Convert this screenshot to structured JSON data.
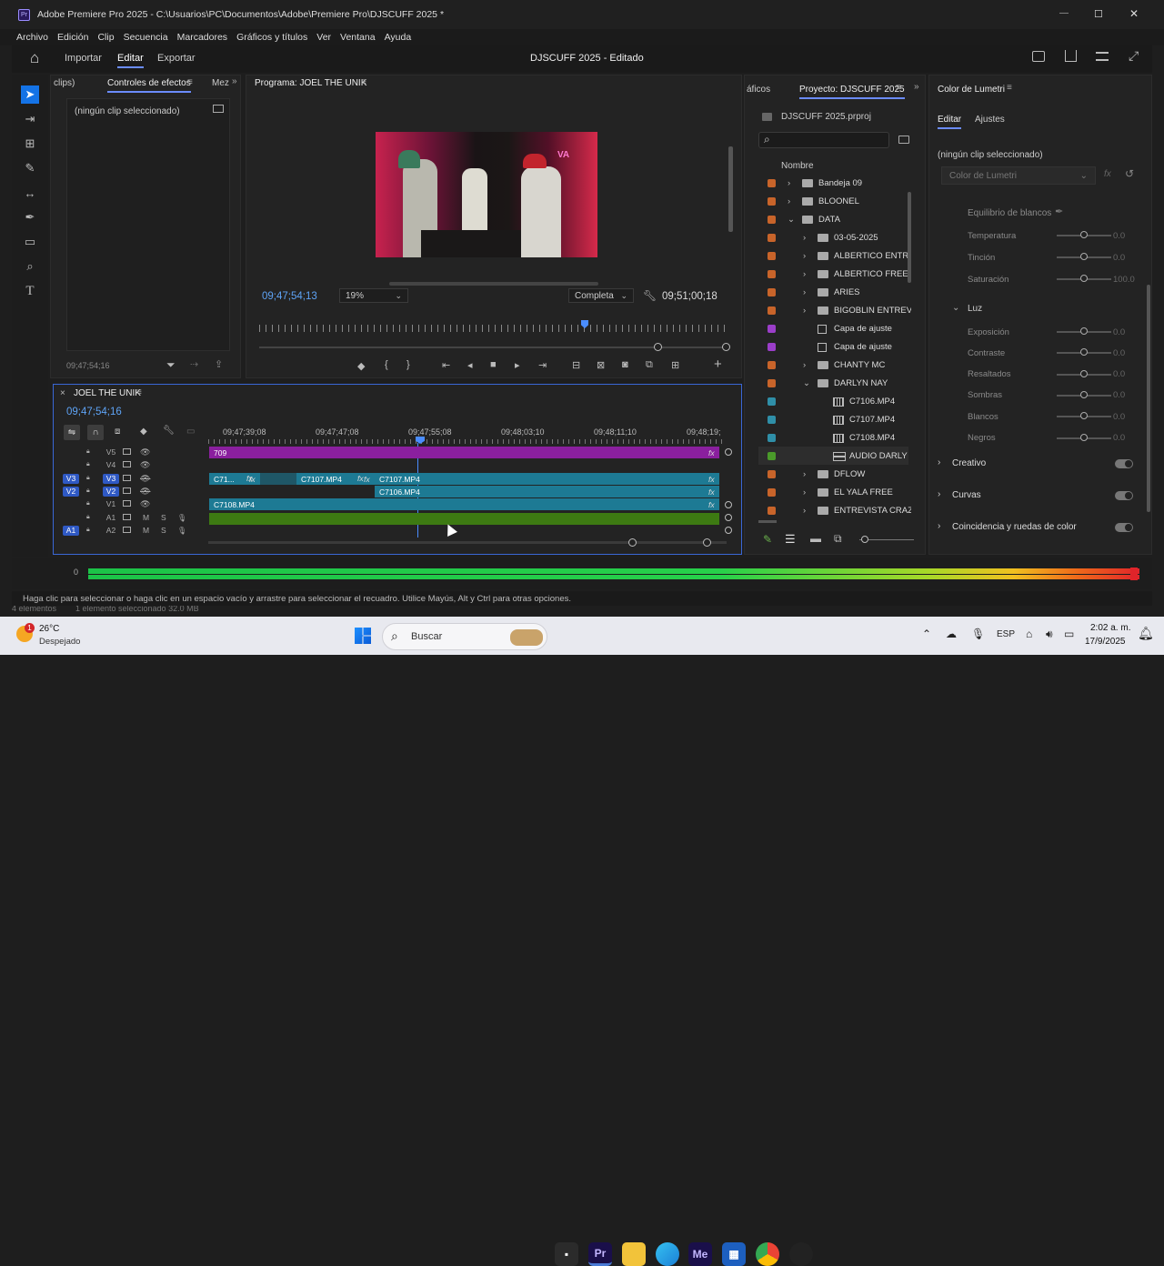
{
  "window": {
    "title": "Adobe Premiere Pro 2025 - C:\\Usuarios\\PC\\Documentos\\Adobe\\Premiere Pro\\DJSCUFF 2025 *",
    "min": "—",
    "max": "☐",
    "close": "✕"
  },
  "menu": [
    "Archivo",
    "Edición",
    "Clip",
    "Secuencia",
    "Marcadores",
    "Gráficos y títulos",
    "Ver",
    "Ventana",
    "Ayuda"
  ],
  "topbar": {
    "home": "⌂",
    "tabs": [
      "Importar",
      "Editar",
      "Exportar"
    ],
    "title": "DJSCUFF 2025 - Editado"
  },
  "source": {
    "tabs": [
      "clips)",
      "Controles de efectos",
      "Mez"
    ],
    "noclip": "(ningún clip seleccionado)",
    "timecode": "09;47;54;16"
  },
  "program": {
    "tab": "Programa: JOEL THE UNIK",
    "tc_left": "09;47;54;13",
    "zoom": "19%",
    "quality": "Completa",
    "tc_right": "09;51;00;18"
  },
  "project": {
    "tabs": [
      "áficos",
      "Proyecto: DJSCUFF 2025"
    ],
    "file": "DJSCUFF 2025.prproj",
    "col_name": "Nombre",
    "items": [
      {
        "name": "Bandeja 09",
        "color": "#c8642a",
        "indent": 0,
        "type": "folder",
        "arrow": "›"
      },
      {
        "name": "BLOONEL",
        "color": "#c8642a",
        "indent": 0,
        "type": "folder",
        "arrow": "›"
      },
      {
        "name": "DATA",
        "color": "#c8642a",
        "indent": 0,
        "type": "folder",
        "arrow": "⌄"
      },
      {
        "name": "03-05-2025",
        "color": "#c8642a",
        "indent": 1,
        "type": "folder",
        "arrow": "›"
      },
      {
        "name": "ALBERTICO ENTRE",
        "color": "#c8642a",
        "indent": 1,
        "type": "folder",
        "arrow": "›"
      },
      {
        "name": "ALBERTICO FREE",
        "color": "#c8642a",
        "indent": 1,
        "type": "folder",
        "arrow": "›"
      },
      {
        "name": "ARIES",
        "color": "#c8642a",
        "indent": 1,
        "type": "folder",
        "arrow": "›"
      },
      {
        "name": "BIGOBLIN ENTREV",
        "color": "#c8642a",
        "indent": 1,
        "type": "folder",
        "arrow": "›"
      },
      {
        "name": "Capa de ajuste",
        "color": "#9b3ec9",
        "indent": 1,
        "type": "adj",
        "arrow": ""
      },
      {
        "name": "Capa de ajuste",
        "color": "#9b3ec9",
        "indent": 1,
        "type": "adj",
        "arrow": ""
      },
      {
        "name": "CHANTY MC",
        "color": "#c8642a",
        "indent": 1,
        "type": "folder",
        "arrow": "›"
      },
      {
        "name": "DARLYN NAY",
        "color": "#c8642a",
        "indent": 1,
        "type": "folder",
        "arrow": "⌄"
      },
      {
        "name": "C7106.MP4",
        "color": "#2f8fa8",
        "indent": 2,
        "type": "video",
        "arrow": ""
      },
      {
        "name": "C7107.MP4",
        "color": "#2f8fa8",
        "indent": 2,
        "type": "video",
        "arrow": ""
      },
      {
        "name": "C7108.MP4",
        "color": "#2f8fa8",
        "indent": 2,
        "type": "video",
        "arrow": ""
      },
      {
        "name": "AUDIO DARLY",
        "color": "#4a9a2a",
        "indent": 2,
        "type": "audio",
        "arrow": ""
      },
      {
        "name": "DFLOW",
        "color": "#c8642a",
        "indent": 1,
        "type": "folder",
        "arrow": "›"
      },
      {
        "name": "EL YALA FREE",
        "color": "#c8642a",
        "indent": 1,
        "type": "folder",
        "arrow": "›"
      },
      {
        "name": "ENTREVISTA CRAZ",
        "color": "#c8642a",
        "indent": 1,
        "type": "folder",
        "arrow": "›"
      }
    ]
  },
  "lumetri": {
    "tab": "Color de Lumetri",
    "subtabs": [
      "Editar",
      "Ajustes"
    ],
    "noclip": "(ningún clip seleccionado)",
    "dropdown": "Color de Lumetri",
    "wb": "Equilibrio de blancos",
    "rows": [
      {
        "label": "Temperatura",
        "value": "0.0"
      },
      {
        "label": "Tinción",
        "value": "0.0"
      },
      {
        "label": "Saturación",
        "value": "100.0"
      }
    ],
    "luz": "Luz",
    "luzrows": [
      {
        "label": "Exposición",
        "value": "0.0"
      },
      {
        "label": "Contraste",
        "value": "0.0"
      },
      {
        "label": "Resaltados",
        "value": "0.0"
      },
      {
        "label": "Sombras",
        "value": "0.0"
      },
      {
        "label": "Blancos",
        "value": "0.0"
      },
      {
        "label": "Negros",
        "value": "0.0"
      }
    ],
    "sections": [
      "Creativo",
      "Curvas",
      "Coincidencia y ruedas de color"
    ]
  },
  "timeline": {
    "tab": "JOEL THE UNIK",
    "timecode": "09;47;54;16",
    "ruler": [
      "09;47;39;08",
      "09;47;47;08",
      "09;47;55;08",
      "09;48;03;10",
      "09;48;11;10",
      "09;48;19;"
    ],
    "tracks": [
      {
        "name": "V5",
        "badge": ""
      },
      {
        "name": "V4",
        "badge": ""
      },
      {
        "name": "V3",
        "badge": "V3"
      },
      {
        "name": "V2",
        "badge": "V2"
      },
      {
        "name": "V1",
        "badge": ""
      },
      {
        "name": "A1",
        "badge": "",
        "m": "M",
        "s": "S"
      },
      {
        "name": "A2",
        "badge": "A1",
        "m": "M",
        "s": "S"
      }
    ],
    "clips": {
      "v5": "709",
      "v3a": "C71...",
      "v3b": "C7107.MP4",
      "v3c": "C7107.MP4",
      "v2": "C7106.MP4",
      "v1": "C7108.MP4",
      "fx": "fx"
    }
  },
  "status": "Haga clic para seleccionar o haga clic en un espacio vacío y arrastre para seleccionar el recuadro. Utilice Mayús, Alt y Ctrl para otras opciones.",
  "status2": {
    "left": "4 elementos",
    "mid": "1 elemento seleccionado 32.0 MB"
  },
  "taskbar": {
    "temp": "26°C",
    "weather": "Despejado",
    "search": "Buscar",
    "lang": "ESP",
    "time": "2:02 a. m.",
    "date": "17/9/2025",
    "badge": "1"
  }
}
